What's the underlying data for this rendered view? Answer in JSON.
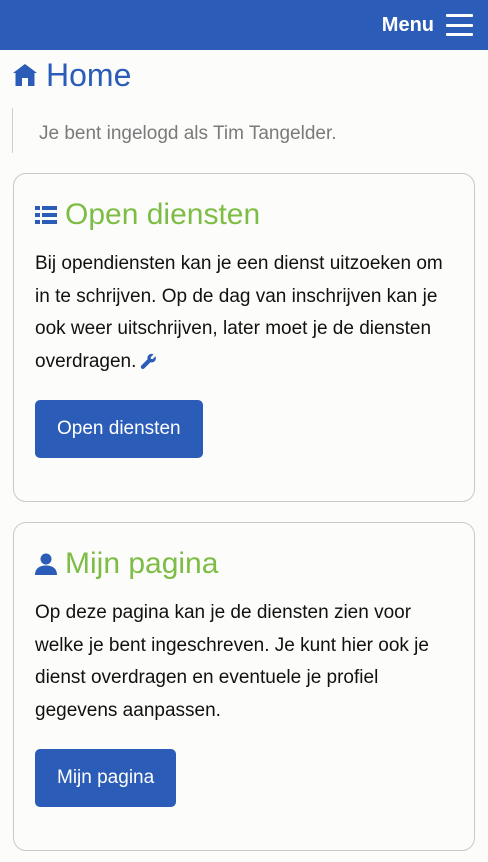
{
  "navbar": {
    "menu_label": "Menu",
    "background": "#2b5cb8"
  },
  "page": {
    "title": "Home",
    "icon": "home-icon"
  },
  "login_note": "Je bent ingelogd als Tim Tangelder.",
  "cards": [
    {
      "icon": "list-icon",
      "title": "Open diensten",
      "text": "Bij opendiensten kan je een dienst uitzoeken om in te schrijven. Op de dag van inschrijven kan je ook weer uitschrijven, later moet je de diensten overdragen.",
      "extra_icon": "wrench-icon",
      "button_label": "Open diensten"
    },
    {
      "icon": "user-icon",
      "title": "Mijn pagina",
      "text": "Op deze pagina kan je de diensten zien voor welke je bent ingeschreven. Je kunt hier ook je dienst overdragen en eventuele je profiel gegevens aanpassen.",
      "button_label": "Mijn pagina"
    }
  ],
  "colors": {
    "primary": "#2b5cb8",
    "card_title": "#7dbd45",
    "muted_text": "#7a7a7a"
  }
}
